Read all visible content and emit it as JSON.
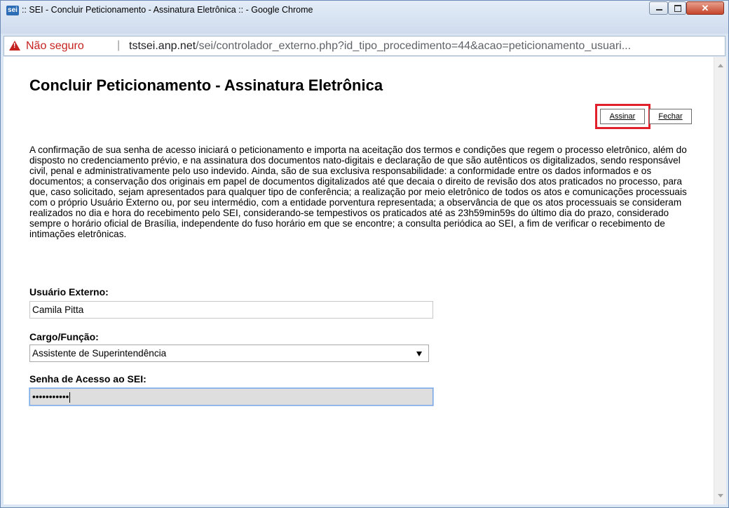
{
  "window": {
    "title": ":: SEI - Concluir Peticionamento - Assinatura Eletrônica :: - Google Chrome",
    "logo": "sei"
  },
  "address": {
    "security_label": "Não seguro",
    "separator": "|",
    "url_host": "tstsei.anp.net",
    "url_path": "/sei/controlador_externo.php?id_tipo_procedimento=44&acao=peticionamento_usuari..."
  },
  "page": {
    "heading": "Concluir Peticionamento - Assinatura Eletrônica",
    "buttons": {
      "sign": "Assinar",
      "close": "Fechar"
    },
    "paragraph": "A confirmação de sua senha de acesso iniciará o peticionamento e importa na aceitação dos termos e condições que regem o processo eletrônico, além do disposto no credenciamento prévio, e na assinatura dos documentos nato-digitais e declaração de que são autênticos os digitalizados, sendo responsável civil, penal e administrativamente pelo uso indevido. Ainda, são de sua exclusiva responsabilidade: a conformidade entre os dados informados e os documentos; a conservação dos originais em papel de documentos digitalizados até que decaia o direito de revisão dos atos praticados no processo, para que, caso solicitado, sejam apresentados para qualquer tipo de conferência; a realização por meio eletrônico de todos os atos e comunicações processuais com o próprio Usuário Externo ou, por seu intermédio, com a entidade porventura representada; a observância de que os atos processuais se consideram realizados no dia e hora do recebimento pelo SEI, considerando-se tempestivos os praticados até as 23h59min59s do último dia do prazo, considerado sempre o horário oficial de Brasília, independente do fuso horário em que se encontre; a consulta periódica ao SEI, a fim de verificar o recebimento de intimações eletrônicas.",
    "form": {
      "user_label": "Usuário Externo:",
      "user_value": "Camila Pitta",
      "role_label": "Cargo/Função:",
      "role_value": "Assistente de Superintendência",
      "password_label": "Senha de Acesso ao SEI:",
      "password_value": "•••••••••••"
    }
  },
  "colors": {
    "highlight": "#e0202a",
    "insecure": "#c5221f"
  }
}
